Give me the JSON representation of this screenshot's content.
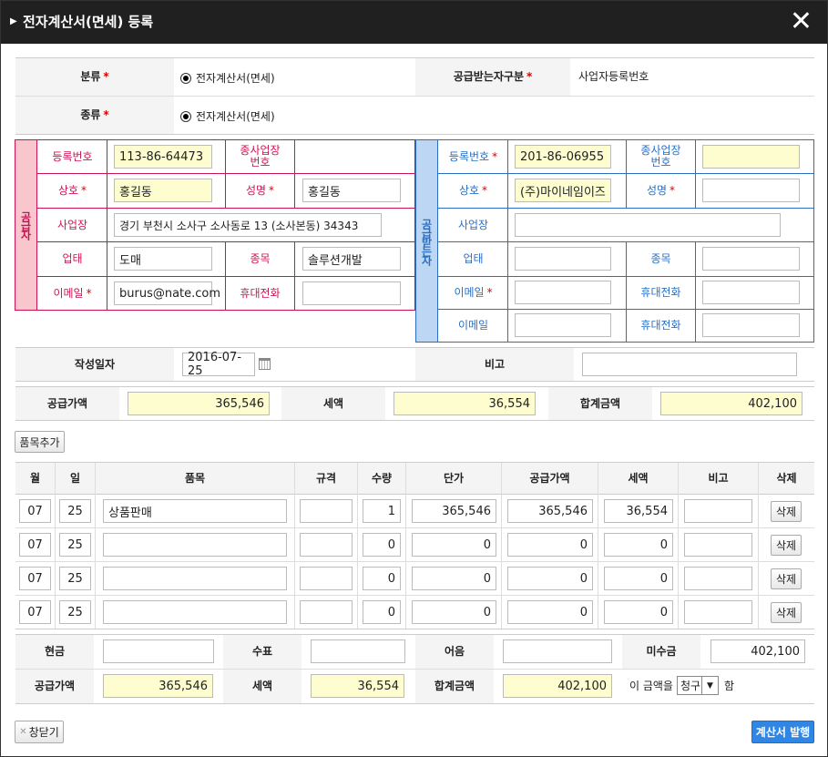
{
  "window": {
    "title": "전자계산서(면세) 등록",
    "close_glyph": "✕",
    "expand_glyph": "▶"
  },
  "top": {
    "category_label": "분류",
    "category_value": "전자계산서(면세)",
    "receiver_type_label": "공급받는자구분",
    "receiver_type_value": "사업자등록번호",
    "kind_label": "종류",
    "kind_value": "전자계산서(면세)"
  },
  "supplier": {
    "side_label": "공급자",
    "reg_no_label": "등록번호",
    "reg_no": "113-86-64473",
    "branch_label": "종사업장\n번호",
    "branch": "",
    "company_label": "상호",
    "company": "홍길동",
    "name_label": "성명",
    "name": "홍길동",
    "address_label": "사업장",
    "address": "경기 부천시 소사구 소사동로 13 (소사본동) 34343",
    "biz_type_label": "업태",
    "biz_type": "도매",
    "item_label": "종목",
    "item": "솔루션개발",
    "email_label": "이메일",
    "email": "burus@nate.com",
    "mobile_label": "휴대전화",
    "mobile": ""
  },
  "receiver": {
    "side_label": "공급받는자",
    "reg_no_label": "등록번호",
    "reg_no": "201-86-06955",
    "branch_label": "종사업장\n번호",
    "branch": "",
    "company_label": "상호",
    "company": "(주)마이네임이즈",
    "name_label": "성명",
    "name": "",
    "address_label": "사업장",
    "address": "",
    "biz_type_label": "업태",
    "biz_type": "",
    "item_label": "종목",
    "item": "",
    "email_label": "이메일",
    "email": "",
    "mobile_label": "휴대전화",
    "mobile": "",
    "email2_label": "이메일",
    "email2": "",
    "mobile2_label": "휴대전화",
    "mobile2": ""
  },
  "date": {
    "label": "작성일자",
    "value": "2016-07-25",
    "note_label": "비고",
    "note": ""
  },
  "totals": {
    "supply_label": "공급가액",
    "supply": "365,546",
    "tax_label": "세액",
    "tax": "36,554",
    "sum_label": "합계금액",
    "sum": "402,100"
  },
  "add_item_label": "품목추가",
  "items": {
    "headers": [
      "월",
      "일",
      "품목",
      "규격",
      "수량",
      "단가",
      "공급가액",
      "세액",
      "비고",
      "삭제"
    ],
    "delete_label": "삭제",
    "rows": [
      {
        "month": "07",
        "day": "25",
        "name": "상품판매",
        "spec": "",
        "qty": "1",
        "price": "365,546",
        "supply": "365,546",
        "tax": "36,554",
        "note": ""
      },
      {
        "month": "07",
        "day": "25",
        "name": "",
        "spec": "",
        "qty": "0",
        "price": "0",
        "supply": "0",
        "tax": "0",
        "note": ""
      },
      {
        "month": "07",
        "day": "25",
        "name": "",
        "spec": "",
        "qty": "0",
        "price": "0",
        "supply": "0",
        "tax": "0",
        "note": ""
      },
      {
        "month": "07",
        "day": "25",
        "name": "",
        "spec": "",
        "qty": "0",
        "price": "0",
        "supply": "0",
        "tax": "0",
        "note": ""
      }
    ]
  },
  "payment": {
    "cash_label": "현금",
    "cash": "",
    "check_label": "수표",
    "check": "",
    "note_label": "어음",
    "note": "",
    "credit_label": "미수금",
    "credit": "402,100",
    "supply_label": "공급가액",
    "supply": "365,546",
    "tax_label": "세액",
    "tax": "36,554",
    "sum_label": "합계금액",
    "sum": "402,100",
    "claim_prefix": "이 금액을",
    "claim_value": "청구",
    "claim_suffix": "함"
  },
  "footer": {
    "close_label": "창닫기",
    "close_glyph": "✕",
    "issue_label": "계산서 발행"
  },
  "colors": {
    "supplier": "#cc1455",
    "supplier_bg": "#f9c6ce",
    "receiver": "#2b6fc5",
    "receiver_bg": "#bcd6f4",
    "input_yellow": "#fdfdd0",
    "issue_button": "#2f86e5"
  }
}
